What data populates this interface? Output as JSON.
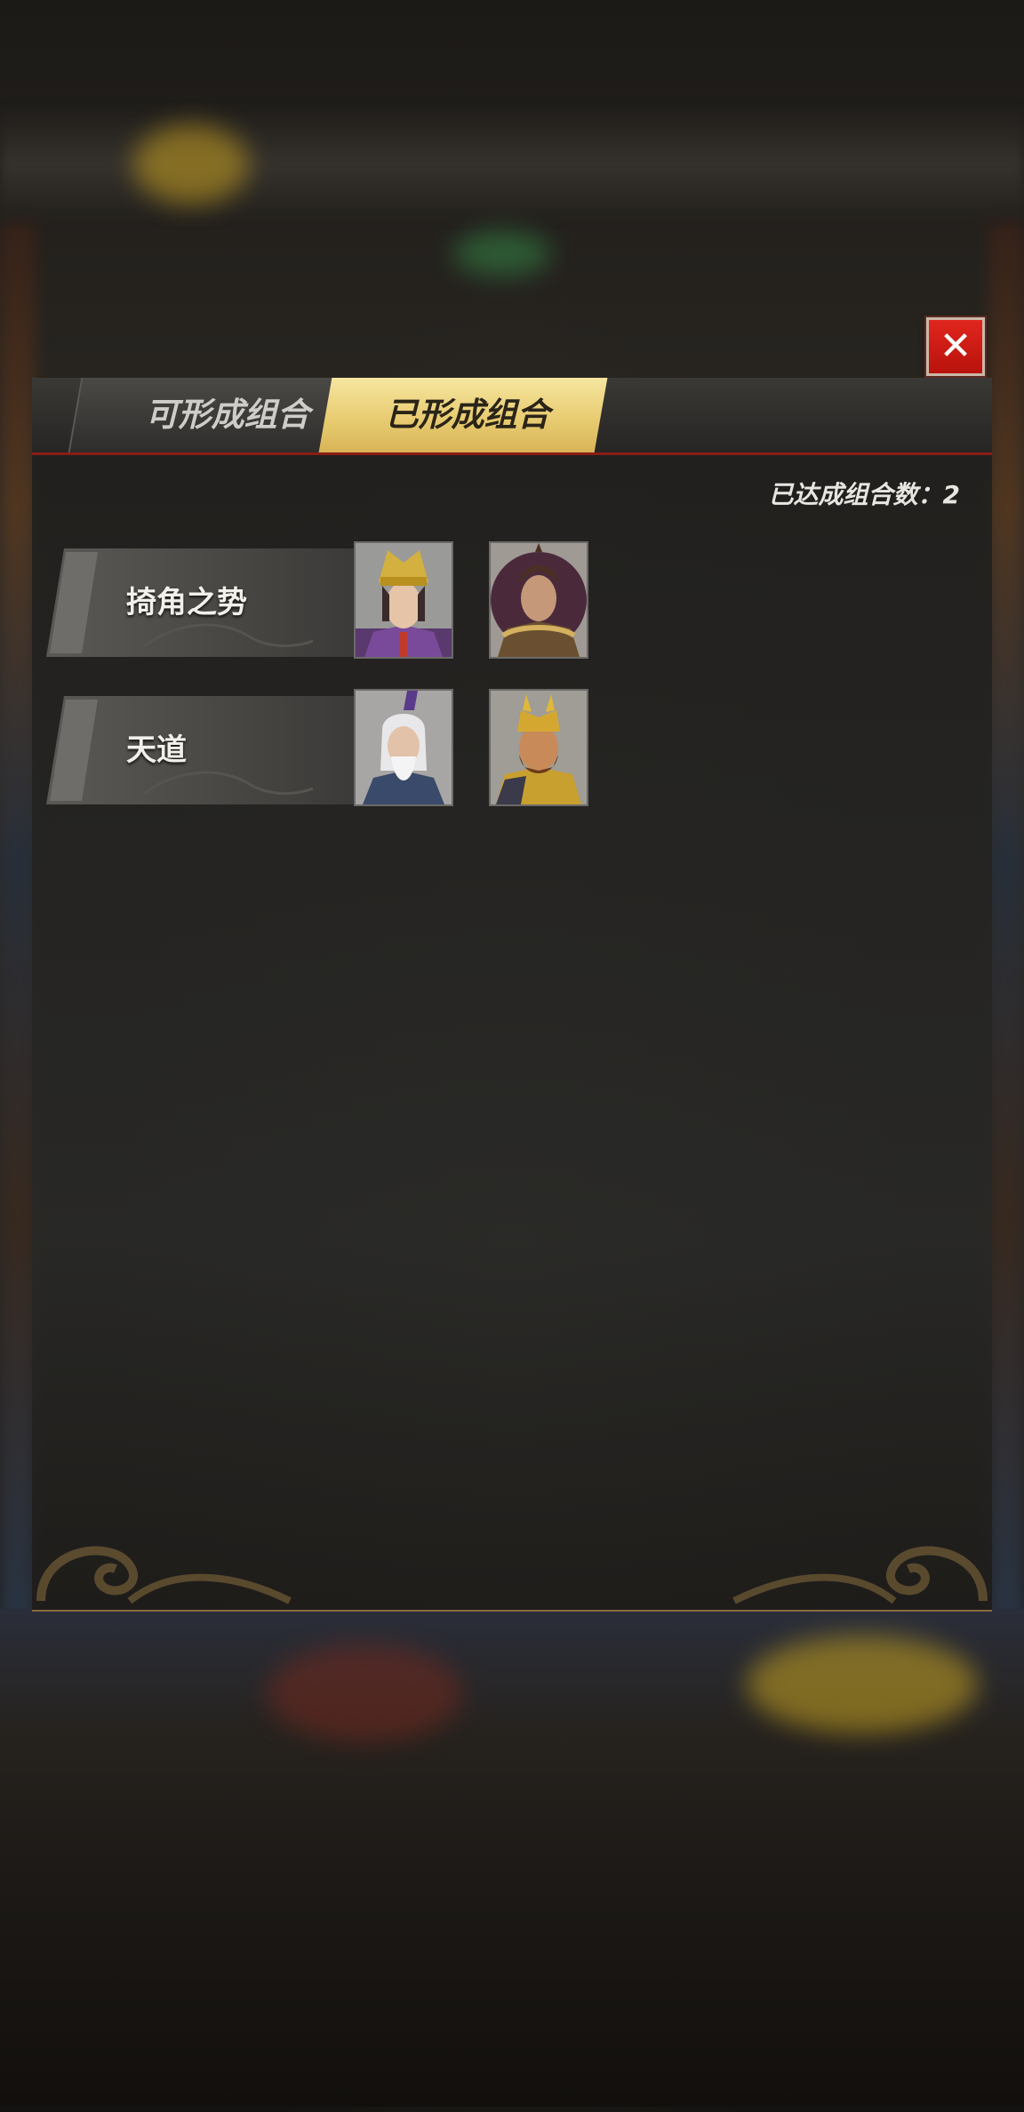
{
  "dialog": {
    "tabs": [
      {
        "label": "可形成组合",
        "active": false
      },
      {
        "label": "已形成组合",
        "active": true
      }
    ],
    "count_label": "已达成组合数：2",
    "combos": [
      {
        "name": "掎角之势",
        "heroes": [
          "hero-portrait-purple-scholar",
          "hero-portrait-brown-warrior"
        ]
      },
      {
        "name": "天道",
        "heroes": [
          "hero-portrait-white-haired-sage",
          "hero-portrait-golden-crowned-warrior"
        ]
      }
    ],
    "close_icon": "close-icon"
  },
  "colors": {
    "active_tab": "#e8cc72",
    "close_button": "#d01a14",
    "tab_underline": "#8a1d14"
  }
}
